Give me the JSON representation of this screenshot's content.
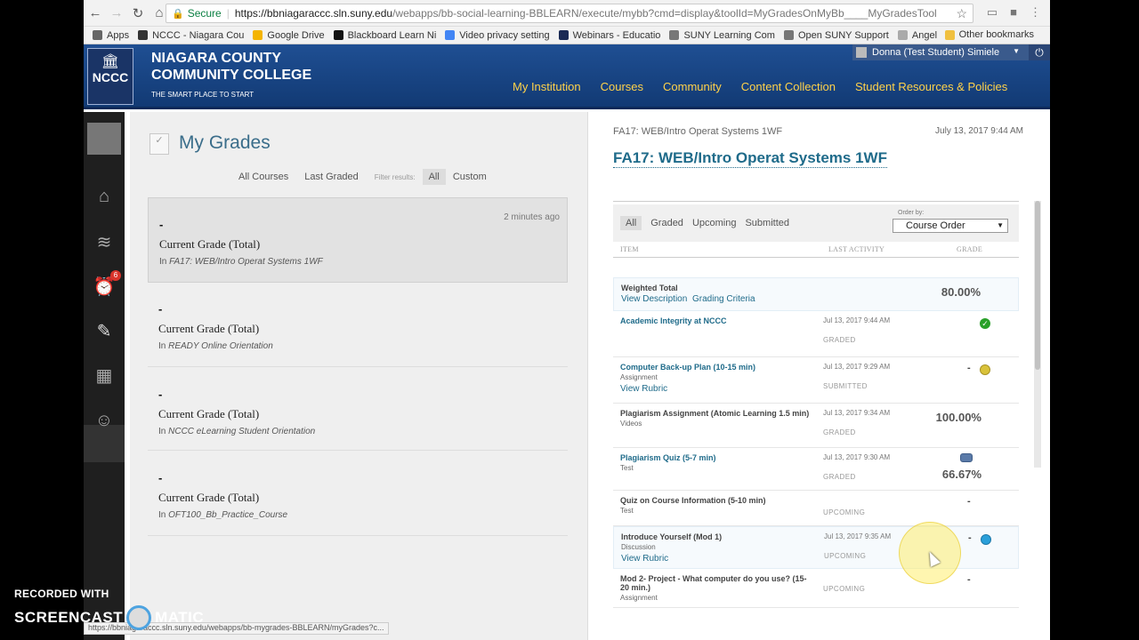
{
  "browser": {
    "secure_label": "Secure",
    "url_host": "https://bbniagaraccc.sln.suny.edu",
    "url_path": "/webapps/bb-social-learning-BBLEARN/execute/mybb?cmd=display&toolId=MyGradesOnMyBb____MyGradesTool",
    "status_url": "https://bbniagaraccc.sln.suny.edu/webapps/bb-mygrades-BBLEARN/myGrades?c...",
    "bookmarks": [
      {
        "label": "Apps",
        "color": "#666666"
      },
      {
        "label": "NCCC - Niagara Cou",
        "color": "#333333"
      },
      {
        "label": "Google Drive",
        "color": "#f4b400"
      },
      {
        "label": "Blackboard Learn Ni",
        "color": "#111111"
      },
      {
        "label": "Video privacy setting",
        "color": "#4285f4"
      },
      {
        "label": "Webinars - Educatio",
        "color": "#1a2a55"
      },
      {
        "label": "SUNY Learning Com",
        "color": "#777777"
      },
      {
        "label": "Open SUNY Support",
        "color": "#777777"
      },
      {
        "label": "Angel",
        "color": "#aaaaaa"
      }
    ],
    "other_bookmarks": "Other bookmarks"
  },
  "header": {
    "college_line1": "NIAGARA COUNTY",
    "college_line2": "COMMUNITY COLLEGE",
    "tagline": "THE SMART PLACE TO START",
    "logo_text": "NCCC",
    "user": "Donna (Test Student) Simiele",
    "nav": [
      "My Institution",
      "Courses",
      "Community",
      "Content Collection",
      "Student Resources & Policies"
    ]
  },
  "sidebar": {
    "badge_count": "6",
    "icons": [
      "avatar",
      "blackboard-home-icon",
      "stream-icon",
      "updates-icon",
      "grades-icon",
      "calendar-icon",
      "profile-icon"
    ]
  },
  "grades": {
    "title": "My Grades",
    "filters": {
      "all_courses": "All Courses",
      "last_graded": "Last Graded",
      "filter_label": "Filter results:",
      "all": "All",
      "custom": "Custom"
    },
    "cards": [
      {
        "dash": "-",
        "label": "Current Grade (Total)",
        "in": "In",
        "course": "FA17: WEB/Intro Operat Systems 1WF",
        "ago": "2 minutes ago"
      },
      {
        "dash": "-",
        "label": "Current Grade (Total)",
        "in": "In",
        "course": "READY Online Orientation",
        "ago": ""
      },
      {
        "dash": "-",
        "label": "Current Grade (Total)",
        "in": "In",
        "course": "NCCC eLearning Student Orientation",
        "ago": ""
      },
      {
        "dash": "-",
        "label": "Current Grade (Total)",
        "in": "In",
        "course": "OFT100_Bb_Practice_Course",
        "ago": ""
      }
    ]
  },
  "detail": {
    "course_code": "FA17: WEB/Intro Operat Systems 1WF",
    "date": "July 13, 2017 9:44 AM",
    "title": "FA17: WEB/Intro Operat Systems 1WF",
    "tabs": [
      "All",
      "Graded",
      "Upcoming",
      "Submitted"
    ],
    "order_label": "Order by:",
    "order_value": "Course Order",
    "col_item": "Item",
    "col_activity": "Last Activity",
    "col_grade": "Grade",
    "rows": [
      {
        "name": "Weighted Total",
        "type": "",
        "link1": "View Description",
        "link2": "Grading Criteria",
        "activity": "",
        "status": "",
        "grade": "80.00%",
        "icon": ""
      },
      {
        "name": "Academic Integrity at NCCC",
        "type": "",
        "link1": "",
        "link2": "",
        "activity": "Jul 13, 2017 9:44 AM",
        "status": "Graded",
        "grade": "",
        "icon": "graded"
      },
      {
        "name": "Computer Back-up Plan (10-15 min)",
        "type": "Assignment",
        "link1": "View Rubric",
        "link2": "",
        "activity": "Jul 13, 2017 9:29 AM",
        "status": "Submitted",
        "grade": "-",
        "icon": "submitted"
      },
      {
        "name": "Plagiarism Assignment (Atomic Learning 1.5 min)",
        "type": "Videos",
        "link1": "",
        "link2": "",
        "activity": "Jul 13, 2017 9:34 AM",
        "status": "Graded",
        "grade": "100.00%",
        "icon": ""
      },
      {
        "name": "Plagiarism Quiz (5-7 min)",
        "type": "Test",
        "link1": "",
        "link2": "",
        "activity": "Jul 13, 2017 9:30 AM",
        "status": "Graded",
        "grade": "66.67%",
        "icon": "comment"
      },
      {
        "name": "Quiz on Course Information (5-10 min)",
        "type": "Test",
        "link1": "",
        "link2": "",
        "activity": "",
        "status": "Upcoming",
        "grade": "-",
        "icon": ""
      },
      {
        "name": "Introduce Yourself (Mod 1)",
        "type": "Discussion",
        "link1": "View Rubric",
        "link2": "",
        "activity": "Jul 13, 2017 9:35 AM",
        "status": "Upcoming",
        "grade": "-",
        "icon": "upcoming"
      },
      {
        "name": "Mod 2- Project - What computer do you use? (15-20 min.)",
        "type": "Assignment",
        "link1": "",
        "link2": "",
        "activity": "",
        "status": "Upcoming",
        "grade": "-",
        "icon": ""
      }
    ]
  },
  "watermark": {
    "line1": "RECORDED WITH",
    "line2a": "SCREENCAST",
    "line2b": "MATIC"
  },
  "colors": {
    "header_blue": "#1f4f93",
    "nav_gold": "#ffd24a",
    "link_teal": "#1f6b8a"
  }
}
